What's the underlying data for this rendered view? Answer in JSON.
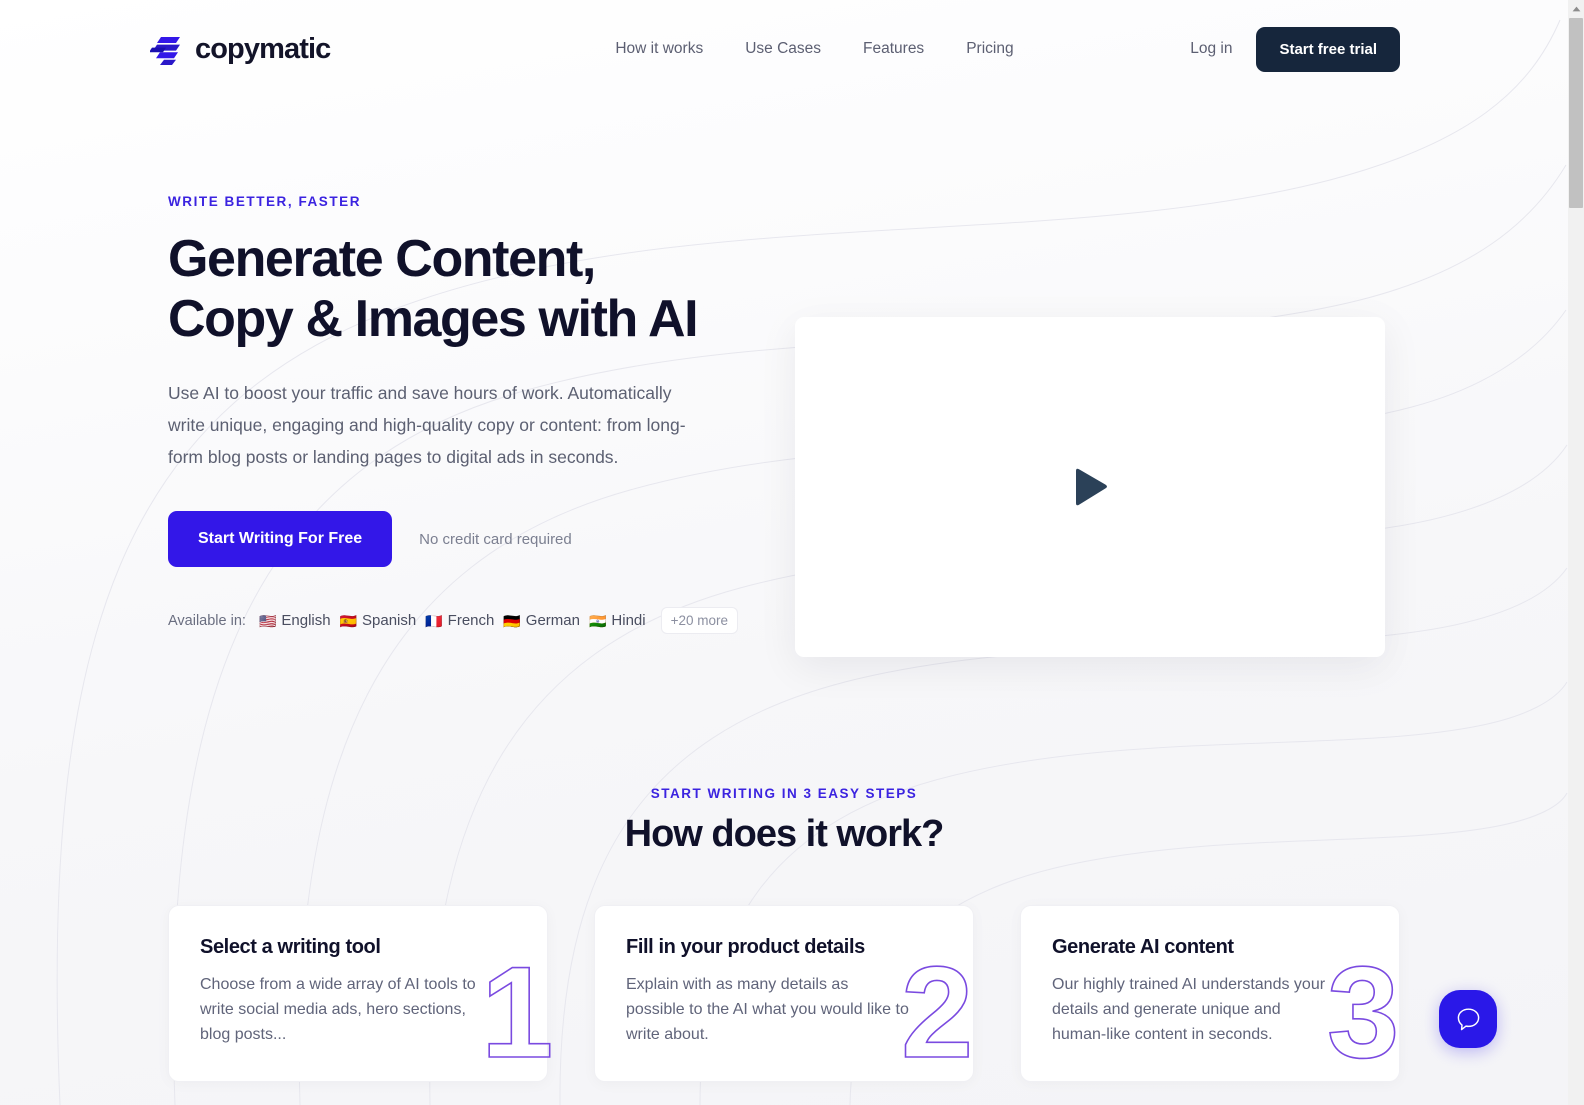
{
  "brand": {
    "name": "copymatic",
    "logo_icon": "copymatic-stacked-bars-logo",
    "accent_color": "#3317e8",
    "dark_color": "#16263c"
  },
  "header": {
    "nav": [
      {
        "label": "How it works",
        "name": "nav-how-it-works"
      },
      {
        "label": "Use Cases",
        "name": "nav-use-cases"
      },
      {
        "label": "Features",
        "name": "nav-features"
      },
      {
        "label": "Pricing",
        "name": "nav-pricing"
      }
    ],
    "login_label": "Log in",
    "trial_label": "Start free trial"
  },
  "hero": {
    "eyebrow": "WRITE BETTER, FASTER",
    "title_line_1": "Generate Content,",
    "title_line_2": "Copy & Images with AI",
    "subtitle": "Use AI to boost your traffic and save hours of work. Automatically write unique, engaging and high-quality copy or content: from long-form blog posts or landing pages to digital ads in seconds.",
    "cta_label": "Start Writing For Free",
    "cta_note": "No credit card required",
    "languages_label": "Available in:",
    "languages": [
      {
        "flag": "🇺🇸",
        "label": "English"
      },
      {
        "flag": "🇪🇸",
        "label": "Spanish"
      },
      {
        "flag": "🇫🇷",
        "label": "French"
      },
      {
        "flag": "🇩🇪",
        "label": "German"
      },
      {
        "flag": "🇮🇳",
        "label": "Hindi"
      }
    ],
    "languages_more": "+20 more",
    "video_play_icon": "play-triangle-icon"
  },
  "how": {
    "eyebrow": "START WRITING IN 3 EASY STEPS",
    "title": "How does it work?",
    "steps": [
      {
        "numeral": "1",
        "title": "Select a writing tool",
        "desc": "Choose from a wide array of AI tools to write social media ads, hero sections, blog posts..."
      },
      {
        "numeral": "2",
        "title": "Fill in your product details",
        "desc": "Explain with as many details as possible to the AI what you would like to write about."
      },
      {
        "numeral": "3",
        "title": "Generate AI content",
        "desc": "Our highly trained AI understands your details and generate unique and human-like content in seconds."
      }
    ]
  },
  "chat": {
    "icon": "chat-bubble-icon"
  },
  "scrollbar": {
    "up_arrow_icon": "scroll-up-arrow-icon"
  }
}
